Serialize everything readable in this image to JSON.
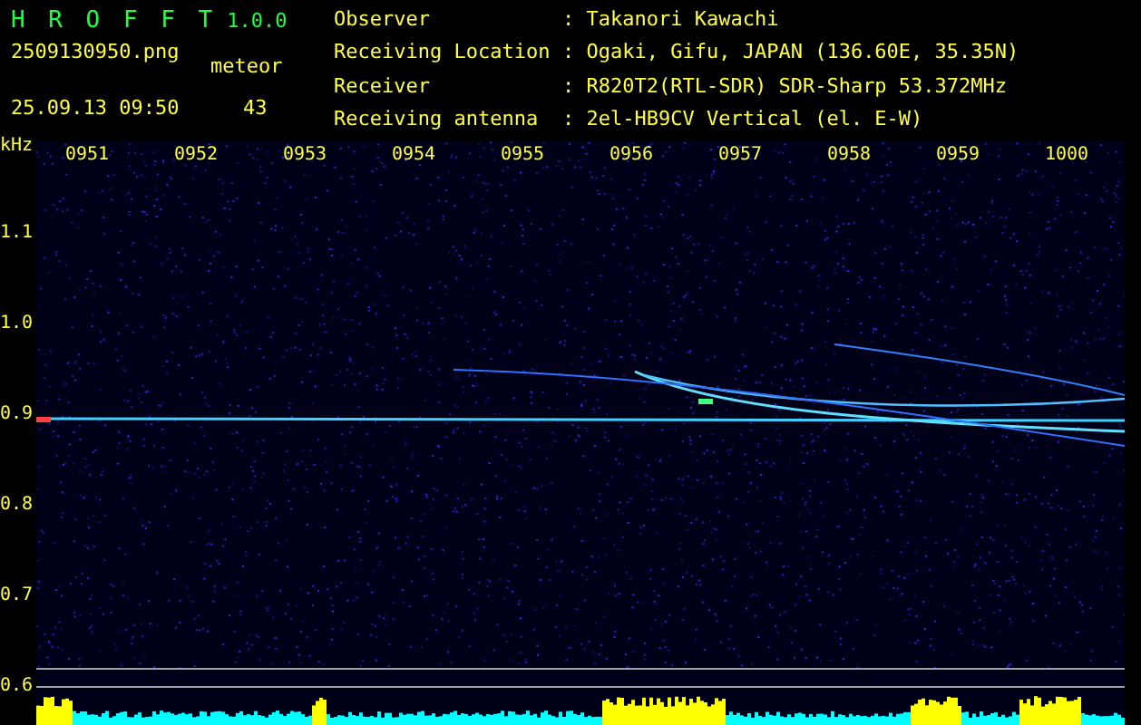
{
  "app": {
    "name": "H R O F F T",
    "version": "1.0.0"
  },
  "file": {
    "name": "2509130950.png",
    "datetime": "25.09.13 09:50"
  },
  "meteor": {
    "label": "meteor",
    "count": "43"
  },
  "info": [
    {
      "label": "Observer",
      "value": ": Takanori Kawachi"
    },
    {
      "label": "Receiving Location",
      "value": ": Ogaki, Gifu, JAPAN (136.60E, 35.35N)"
    },
    {
      "label": "Receiver",
      "value": ": R820T2(RTL-SDR) SDR-Sharp 53.372MHz"
    },
    {
      "label": "Receiving antenna",
      "value": ": 2el-HB9CV Vertical (el. E-W)"
    }
  ],
  "spectrogram": {
    "y_unit": "kHz",
    "x_labels": [
      "0951",
      "0952",
      "0953",
      "0954",
      "0955",
      "0956",
      "0957",
      "0958",
      "0959",
      "1000"
    ],
    "y_labels": [
      "1.1",
      "1.0",
      "0.9",
      "0.8",
      "0.7",
      "0.6"
    ]
  }
}
